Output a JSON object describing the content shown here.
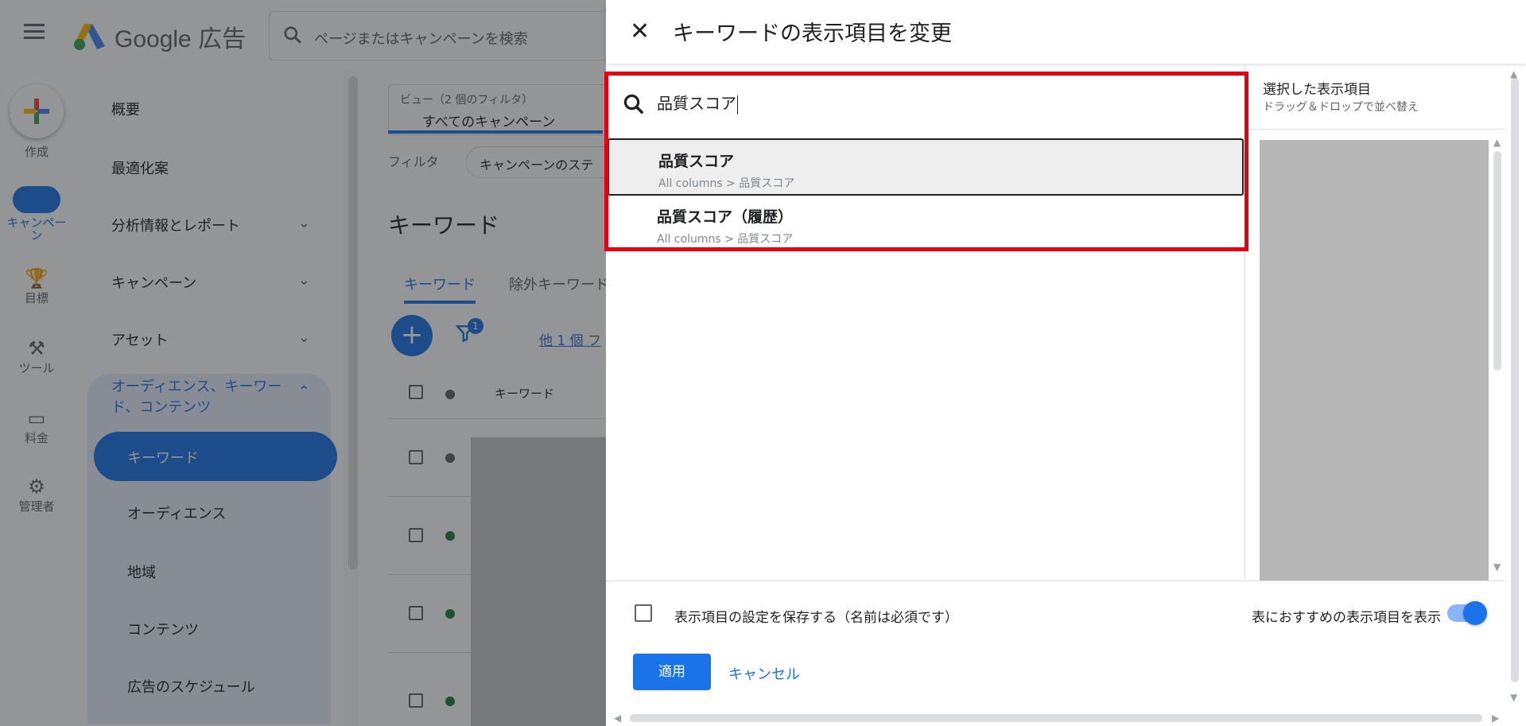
{
  "app": {
    "logo_text": "Google 広告",
    "search_placeholder": "ページまたはキャンペーンを検索"
  },
  "rail": {
    "create": "作成",
    "campaigns": "キャンペーン",
    "goals": "目標",
    "tools": "ツール",
    "billing": "料金",
    "admin": "管理者"
  },
  "sidebar": {
    "overview": "概要",
    "recommendations": "最適化案",
    "insights": "分析情報とレポート",
    "campaigns": "キャンペーン",
    "assets": "アセット",
    "audiences_group": "オーディエンス、キーワード、コンテンツ",
    "keywords": "キーワード",
    "audiences": "オーディエンス",
    "locations": "地域",
    "content": "コンテンツ",
    "ad_schedule": "広告のスケジュール"
  },
  "main": {
    "view_small": "ビュー（2 個のフィルタ）",
    "view_value": "すべてのキャンペーン",
    "filter_label": "フィルタ",
    "filter_chip": "キャンペーンのステ",
    "page_title": "キーワード",
    "tab_keywords": "キーワード",
    "tab_negative": "除外キーワード",
    "filter_badge": "1",
    "other_link": "他 1 個",
    "other_trailing": "フ",
    "col_keyword": "キーワード"
  },
  "panel": {
    "title": "キーワードの表示項目を変更",
    "search_value": "品質スコア",
    "results": [
      {
        "title": "品質スコア",
        "path": "All columns > 品質スコア"
      },
      {
        "title": "品質スコア（履歴）",
        "path": "All columns > 品質スコア"
      }
    ],
    "selected_title": "選択した表示項目",
    "selected_sub": "ドラッグ＆ドロップで並べ替え",
    "save_label": "表示項目の設定を保存する（名前は必須です）",
    "recommended_label": "表におすすめの表示項目を表示",
    "apply": "適用",
    "cancel": "キャンセル"
  },
  "colors": {
    "accent": "#1a73e8",
    "highlight_frame": "#e60012"
  }
}
